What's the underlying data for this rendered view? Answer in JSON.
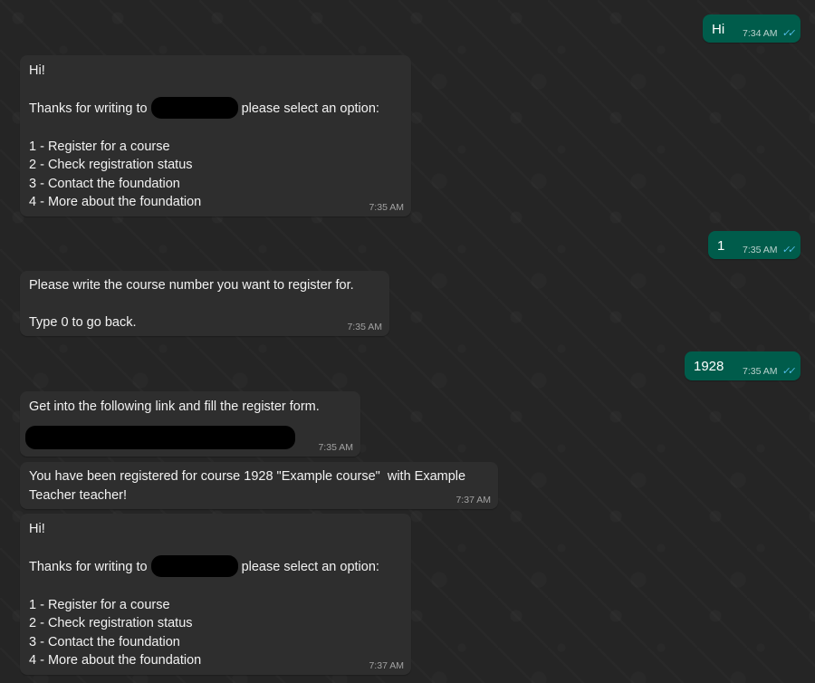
{
  "messages": [
    {
      "direction": "outgoing",
      "text": "Hi",
      "time": "7:34 AM"
    },
    {
      "direction": "incoming",
      "lines": [
        "Hi!",
        "",
        "Thanks for writing to",
        "please select an option:",
        "",
        "1 - Register for a course",
        "2 - Check registration status",
        "3 - Contact the foundation",
        "4 - More about the foundation"
      ],
      "time": "7:35 AM"
    },
    {
      "direction": "outgoing",
      "text": "1",
      "time": "7:35 AM"
    },
    {
      "direction": "incoming",
      "lines": [
        "Please write the course number you want to register for.",
        "",
        "Type 0 to go back."
      ],
      "time": "7:35 AM"
    },
    {
      "direction": "outgoing",
      "text": "1928",
      "time": "7:35 AM"
    },
    {
      "direction": "incoming",
      "lines": [
        "Get into the following link and fill the register form."
      ],
      "time": "7:35 AM"
    },
    {
      "direction": "incoming",
      "lines": [
        "You have been registered for course 1928 \"Example course\"  with Example",
        "Teacher teacher!"
      ],
      "time": "7:37 AM"
    },
    {
      "direction": "incoming",
      "lines": [
        "Hi!",
        "",
        "Thanks for writing to",
        "please select an option:",
        "",
        "1 - Register for a course",
        "2 - Check registration status",
        "3 - Contact the foundation",
        "4 - More about the foundation"
      ],
      "time": "7:37 AM"
    }
  ],
  "colors": {
    "background": "#252525",
    "incoming_bubble": "#2e2e2e",
    "outgoing_bubble": "#005c4b",
    "read_ticks": "#53bdeb"
  },
  "icons": {
    "read_receipt": "double-check-icon"
  }
}
